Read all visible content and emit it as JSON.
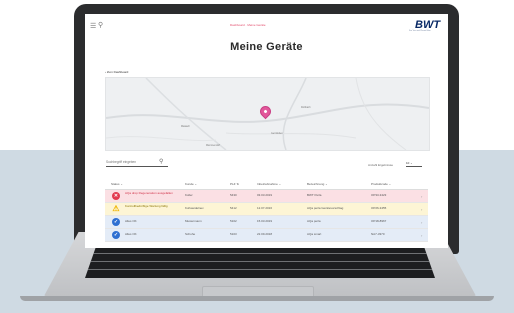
{
  "colors": {
    "background_lower": "#cfdae3",
    "laptop_frame": "#2b2c2e",
    "accent_pink": "#e2579b",
    "brand_navy": "#0a2a66",
    "error_red": "#e23a4f",
    "warning_yellow": "#f0b400",
    "ok_blue": "#2e6fd1"
  },
  "header": {
    "menu_icon": "hamburger-icon",
    "search_icon": "search-icon",
    "breadcrumb": "Dashboard · Meine Geräte",
    "logo_text": "BWT",
    "logo_subtext": "For You and Planet Blue"
  },
  "page": {
    "title": "Meine Geräte",
    "back_link": "‹  Zum Dashboard"
  },
  "map": {
    "labels": [
      "Maisach",
      "Gernlinden",
      "Rottbach",
      "Mammendorf"
    ],
    "fullscreen_icon": "fullscreen-icon",
    "zoom_in": "+",
    "zoom_out": "−"
  },
  "search": {
    "placeholder": "Suchbegriff eingeben",
    "value": ""
  },
  "entries": {
    "label": "Anzahl Ergebnisse",
    "value": "10 ⌄"
  },
  "table": {
    "headers": [
      "Status ⌄",
      "Kunde ⌄",
      "PLZ ⇅",
      "Inbetriebnahme ⌄",
      "Bezeichnung ⌄",
      "Produktcode ⌄"
    ],
    "rows": [
      {
        "status": "AQa drop Regeneration ausgefallen",
        "kunde": "Koller",
        "plz": "5430",
        "datum": "03.03.2019",
        "bezeichnung": "BWT Perla",
        "code": "OP33-3423",
        "tone": "red"
      },
      {
        "status": "Kontrollbedürftige Wartung fällig",
        "kunde": "Kuhweidelnev",
        "plz": "5412",
        "datum": "12.07.2016",
        "bezeichnung": "AQa perla Gerätevorschlag",
        "code": "OP26-3455",
        "tone": "yellow"
      },
      {
        "status": "Alles OK",
        "kunde": "Mustermann",
        "plz": "5102",
        "datum": "15.03.2019",
        "bezeichnung": "AQa perla",
        "code": "OP18-8967",
        "tone": "blue"
      },
      {
        "status": "Alles OK",
        "kunde": "Schuhe",
        "plz": "5103",
        "datum": "22.09.2018",
        "bezeichnung": "AQa smart",
        "code": "NA7-3370",
        "tone": "blue"
      }
    ]
  }
}
